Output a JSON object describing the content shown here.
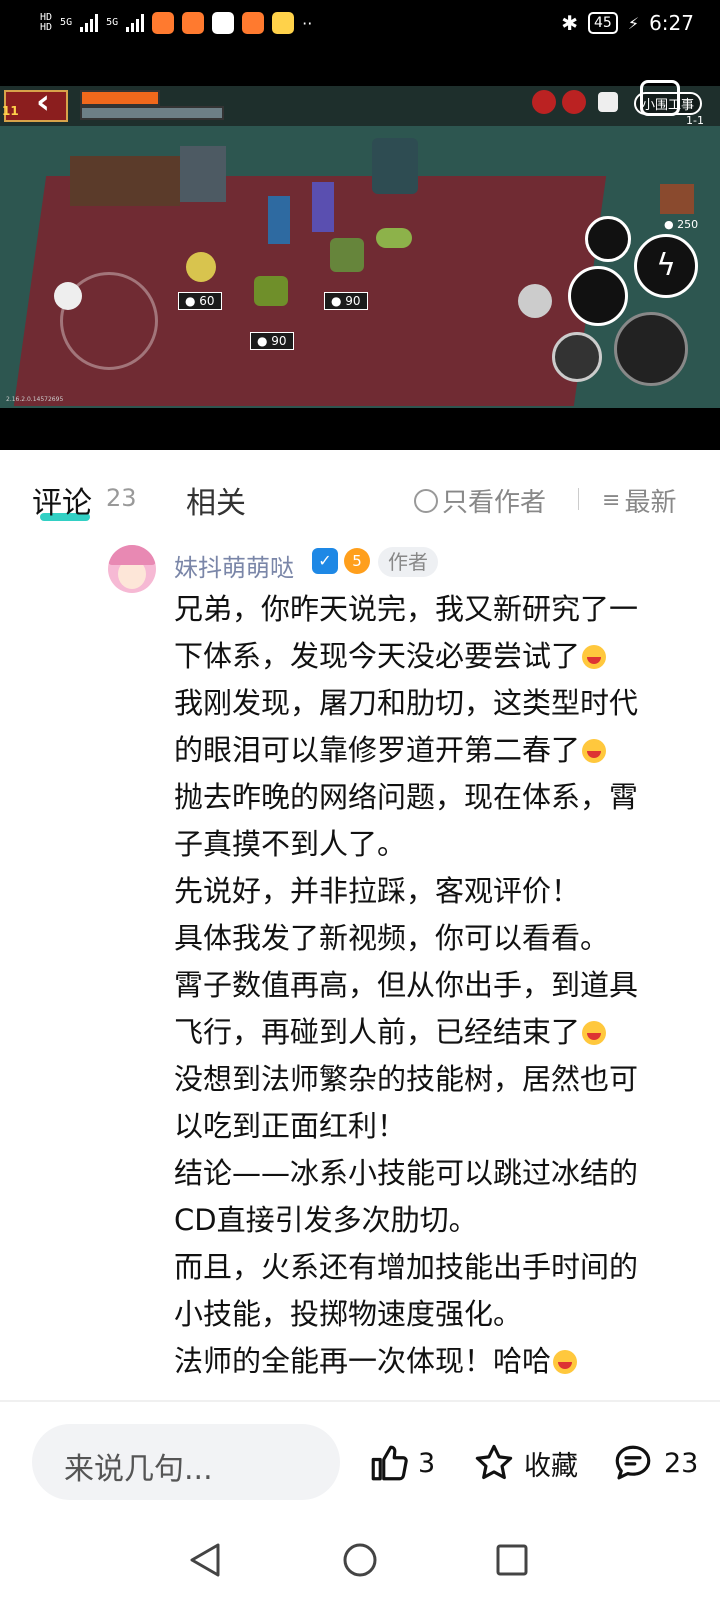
{
  "status_bar": {
    "signal_1": "5G",
    "signal_2": "5G",
    "hd_1": "HD",
    "hd_2": "HD",
    "battery": "45",
    "time": "6:27"
  },
  "video": {
    "overlay_label": "小围工事",
    "level_label": "1-1",
    "player_level": "11",
    "coin_counter": "250",
    "shop_prices": [
      "60",
      "90",
      "90"
    ],
    "version_text": "2.16.2.0.14572695"
  },
  "tabs": {
    "comments_label": "评论",
    "comments_count": "23",
    "related_label": "相关",
    "author_only_label": "只看作者",
    "latest_label": "最新"
  },
  "comment": {
    "username": "妹抖萌萌哒",
    "level_badge": "5",
    "author_tag": "作者",
    "lines": [
      "兄弟，你昨天说完，我又新研究了一",
      "下体系，发现今天没必要尝试了",
      "我刚发现，屠刀和肋切，这类型时代",
      "的眼泪可以靠修罗道开第二春了",
      "抛去昨晚的网络问题，现在体系，霄",
      "子真摸不到人了。",
      "先说好，并非拉踩，客观评价！",
      "具体我发了新视频，你可以看看。",
      "霄子数值再高，但从你出手，到道具",
      "飞行，再碰到人前，已经结束了",
      "没想到法师繁杂的技能树，居然也可",
      "以吃到正面红利！",
      "结论——冰系小技能可以跳过冰结的",
      "CD直接引发多次肋切。",
      "而且，火系还有增加技能出手时间的",
      "小技能，投掷物速度强化。",
      "法师的全能再一次体现！哈哈"
    ]
  },
  "bottom_bar": {
    "input_placeholder": "来说几句...",
    "like_count": "3",
    "favorite_label": "收藏",
    "comment_count": "23"
  },
  "colors": {
    "accent": "#32d0c4",
    "username": "#7a86a8",
    "badge_blue": "#1e88e5",
    "badge_orange": "#ff9f1c"
  }
}
